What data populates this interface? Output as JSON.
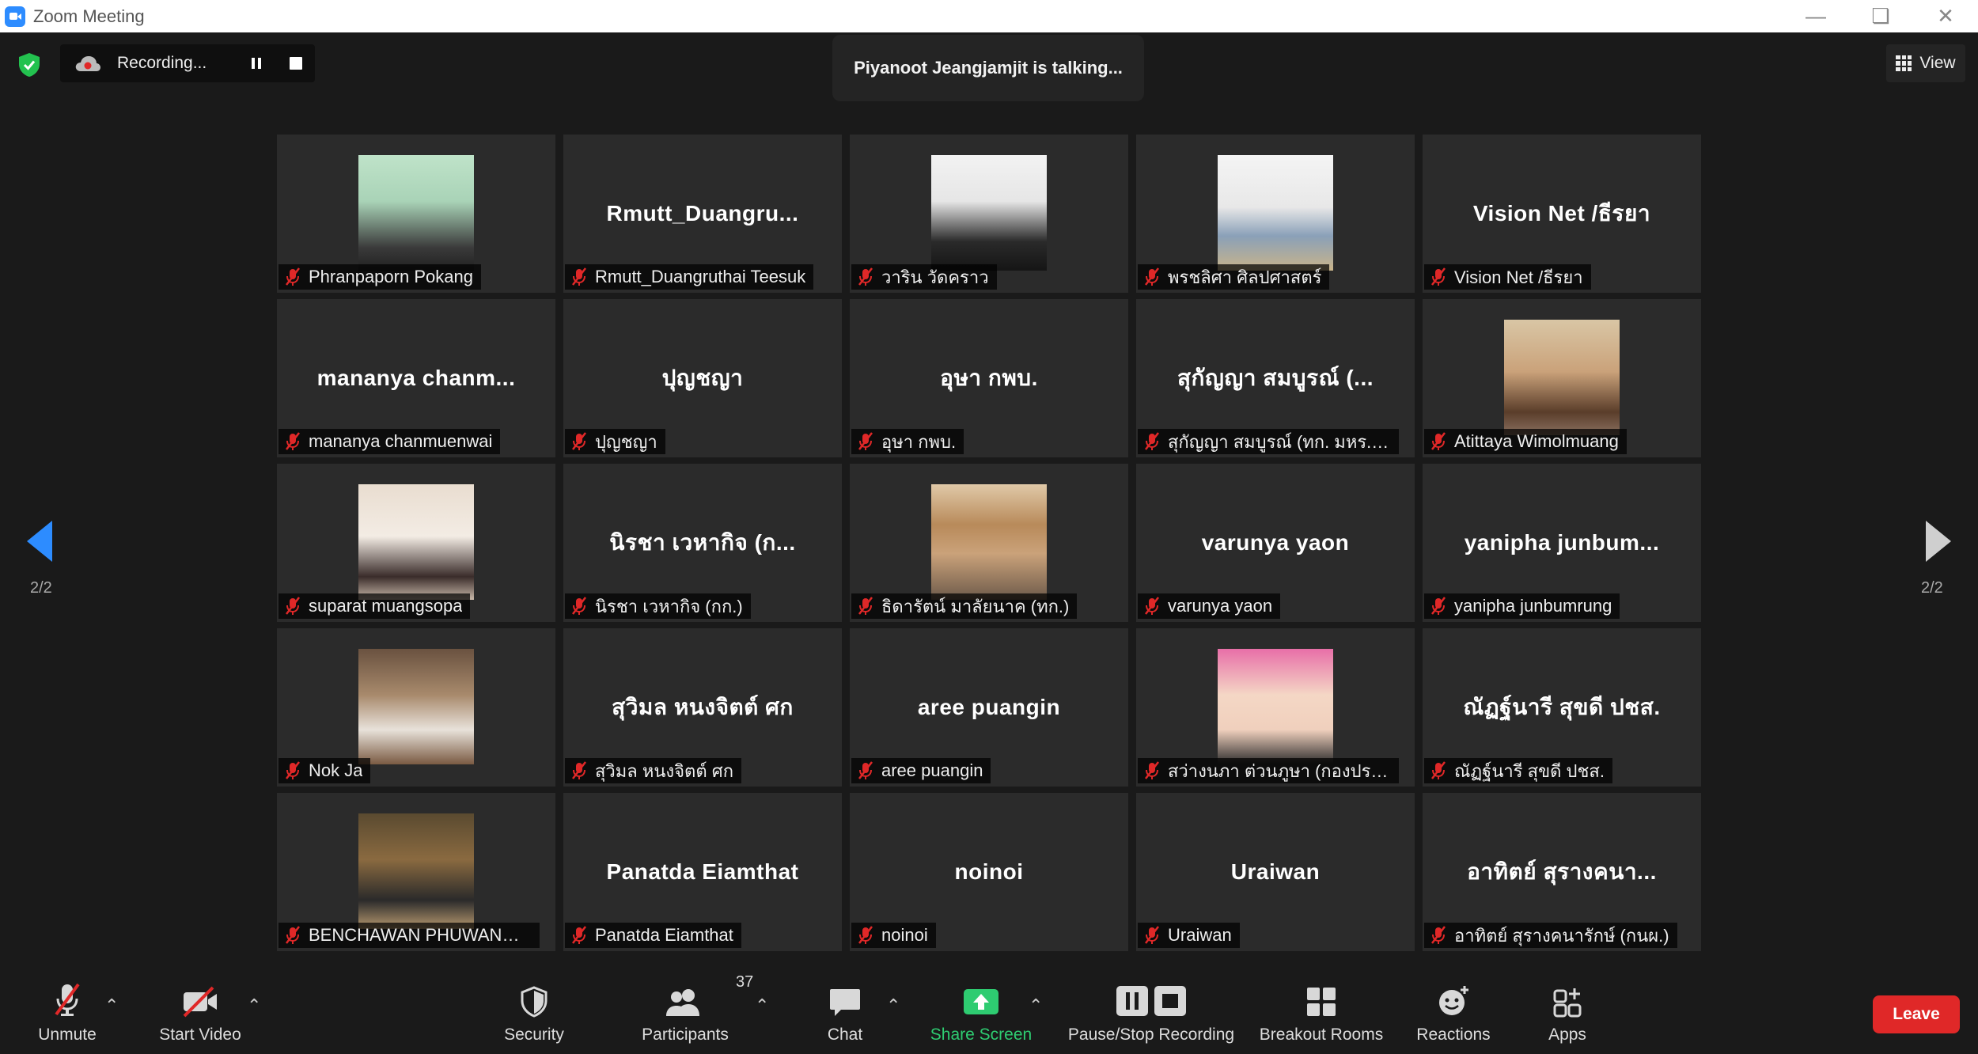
{
  "window": {
    "title": "Zoom Meeting"
  },
  "recording": {
    "label": "Recording..."
  },
  "talking": {
    "text": "Piyanoot Jeangjamjit is talking..."
  },
  "view": {
    "label": "View"
  },
  "pagination": {
    "left": "2/2",
    "right": "2/2"
  },
  "participants_grid": [
    {
      "name": "Phranpaporn Pokang",
      "display": "",
      "photo": "woman-headshot"
    },
    {
      "name": "Rmutt_Duangruthai Teesuk",
      "display": "Rmutt_Duangru...",
      "photo": ""
    },
    {
      "name": "วาริน วัดคราว",
      "display": "",
      "photo": "woman-suit-headshot"
    },
    {
      "name": "พรชลิศา ศิลปศาสตร์",
      "display": "",
      "photo": "document-thumbnail"
    },
    {
      "name": "Vision Net /ธีรยา",
      "display": "Vision Net /ธีรยา",
      "photo": ""
    },
    {
      "name": "mananya chanmuenwai",
      "display": "mananya chanm...",
      "photo": ""
    },
    {
      "name": "ปุญชญา",
      "display": "ปุญชญา",
      "photo": ""
    },
    {
      "name": "อุษา กพบ.",
      "display": "อุษา กพบ.",
      "photo": ""
    },
    {
      "name": "สุกัญญา สมบูรณ์ (ทก. มหร.ธัญ...",
      "display": "สุกัญญา สมบูรณ์ (...",
      "photo": ""
    },
    {
      "name": "Atittaya Wimolmuang",
      "display": "",
      "photo": "woman-selfie"
    },
    {
      "name": "suparat muangsopa",
      "display": "",
      "photo": "woman-mask"
    },
    {
      "name": "นิรชา เวหากิจ (กก.)",
      "display": "นิรชา เวหากิจ (ก...",
      "photo": ""
    },
    {
      "name": "ธิดารัตน์ มาลัยนาค (ทก.)",
      "display": "",
      "photo": "woman-hat"
    },
    {
      "name": "varunya yaon",
      "display": "varunya yaon",
      "photo": ""
    },
    {
      "name": "yanipha junbumrung",
      "display": "yanipha junbum...",
      "photo": ""
    },
    {
      "name": "Nok Ja",
      "display": "",
      "photo": "woman-cafe"
    },
    {
      "name": "สุวิมล หนงจิตต์ ศก",
      "display": "สุวิมล หนงจิตต์ ศก",
      "photo": ""
    },
    {
      "name": "aree puangin",
      "display": "aree puangin",
      "photo": ""
    },
    {
      "name": "สว่างนภา ต่วนภูษา (กองประชาสั...",
      "display": "",
      "photo": "woman-glasses"
    },
    {
      "name": "ณัฏฐ์นารี สุขดี ปชส.",
      "display": "ณัฏฐ์นารี สุขดี ปชส.",
      "photo": ""
    },
    {
      "name": "BENCHAWAN PHUWANGT...",
      "display": "",
      "photo": "woman-seated"
    },
    {
      "name": "Panatda Eiamthat",
      "display": "Panatda Eiamthat",
      "photo": ""
    },
    {
      "name": "noinoi",
      "display": "noinoi",
      "photo": ""
    },
    {
      "name": "Uraiwan",
      "display": "Uraiwan",
      "photo": ""
    },
    {
      "name": "อาทิตย์ สุรางคนารักษ์ (กนผ.)",
      "display": "อาทิตย์ สุรางคนา...",
      "photo": ""
    }
  ],
  "toolbar": {
    "unmute": "Unmute",
    "start_video": "Start Video",
    "security": "Security",
    "participants": "Participants",
    "participants_count": "37",
    "chat": "Chat",
    "share_screen": "Share Screen",
    "pause_stop": "Pause/Stop Recording",
    "breakout": "Breakout Rooms",
    "reactions": "Reactions",
    "apps": "Apps",
    "leave": "Leave"
  },
  "colors": {
    "accent": "#2d8cff",
    "leave": "#e02828",
    "share": "#2ecc71",
    "muted": "#e02828"
  }
}
